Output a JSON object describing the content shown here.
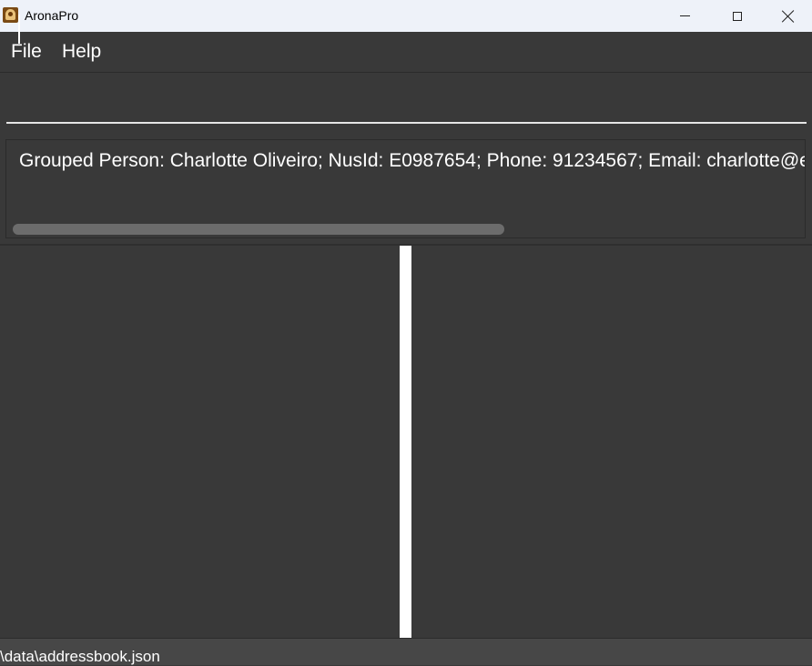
{
  "window": {
    "title": "AronaPro"
  },
  "menu": {
    "items": [
      {
        "label": "File"
      },
      {
        "label": "Help"
      }
    ]
  },
  "command": {
    "value": ""
  },
  "result": {
    "text": "Grouped Person: Charlotte Oliveiro; NusId: E0987654; Phone: 91234567; Email: charlotte@example.com"
  },
  "status": {
    "path": "\\data\\addressbook.json"
  }
}
